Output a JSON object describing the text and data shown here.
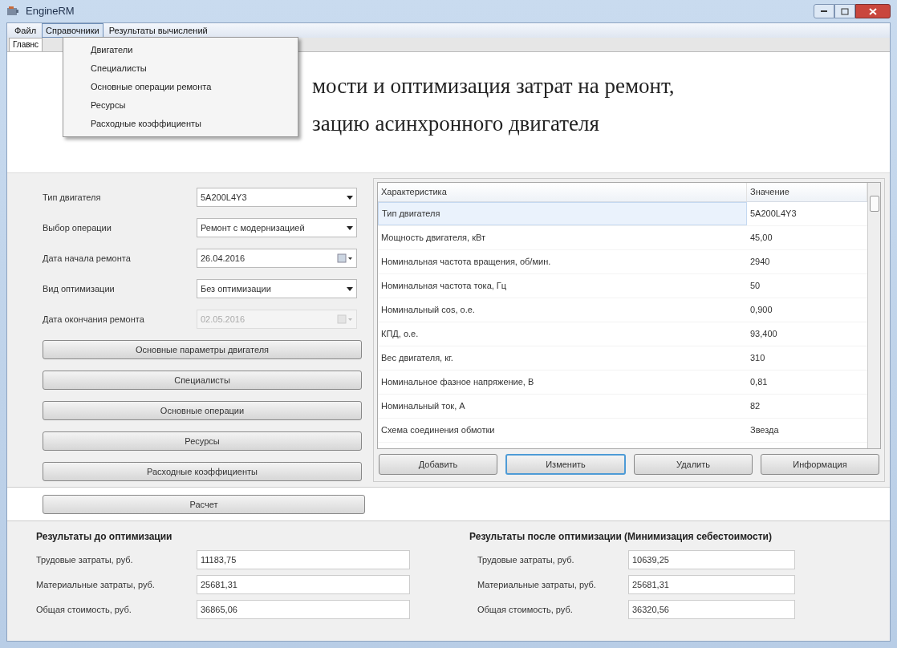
{
  "window": {
    "title": "EngineRM"
  },
  "menu": [
    {
      "label": "Файл",
      "selected": false
    },
    {
      "label": "Справочники",
      "selected": true
    },
    {
      "label": "Результаты вычислений",
      "selected": false
    }
  ],
  "dropdown": [
    "Двигатели",
    "Специалисты",
    "Основные операции ремонта",
    "Ресурсы",
    "Расходные коэффициенты"
  ],
  "tabs": [
    {
      "label": "Главнс",
      "selected": true
    }
  ],
  "heading": [
    "мости и оптимизация затрат на ремонт,",
    "зацию асинхронного двигателя"
  ],
  "form": [
    {
      "label": "Тип двигателя",
      "kind": "combo",
      "value": "5A200L4Y3",
      "disabled": false
    },
    {
      "label": "Выбор операции",
      "kind": "combo",
      "value": "Ремонт с модернизацией",
      "disabled": false
    },
    {
      "label": "Дата начала ремонта",
      "kind": "date",
      "value": "26.04.2016",
      "disabled": false
    },
    {
      "label": "Вид оптимизации",
      "kind": "combo",
      "value": "Без оптимизации",
      "disabled": false
    },
    {
      "label": "Дата окончания ремонта",
      "kind": "date",
      "value": "02.05.2016",
      "disabled": true
    }
  ],
  "side_buttons": [
    "Основные параметры двигателя",
    "Специалисты",
    "Основные операции",
    "Ресурсы",
    "Расходные коэффициенты"
  ],
  "table": {
    "columns": [
      "Характеристика",
      "Значение"
    ],
    "rows": [
      {
        "cells": [
          "Тип двигателя",
          "5A200L4Y3"
        ],
        "selected": true
      },
      {
        "cells": [
          "Мощность двигателя, кВт",
          "45,00"
        ],
        "selected": false
      },
      {
        "cells": [
          "Номинальная частота вращения, об/мин.",
          "2940"
        ],
        "selected": false
      },
      {
        "cells": [
          "Номинальная частота тока, Гц",
          "50"
        ],
        "selected": false
      },
      {
        "cells": [
          "Номинальный cos, о.е.",
          "0,900"
        ],
        "selected": false
      },
      {
        "cells": [
          "КПД, о.е.",
          "93,400"
        ],
        "selected": false
      },
      {
        "cells": [
          "Вес двигателя, кг.",
          "310"
        ],
        "selected": false
      },
      {
        "cells": [
          "Номинальное фазное напряжение, В",
          "0,81"
        ],
        "selected": false
      },
      {
        "cells": [
          "Номинальный ток, А",
          "82"
        ],
        "selected": false
      },
      {
        "cells": [
          "Схема соединения обмотки",
          "Звезда"
        ],
        "selected": false
      }
    ]
  },
  "table_buttons": [
    {
      "label": "Добавить",
      "focused": false
    },
    {
      "label": "Изменить",
      "focused": true
    },
    {
      "label": "Удалить",
      "focused": false
    },
    {
      "label": "Информация",
      "focused": false
    }
  ],
  "calc_button": "Расчет",
  "results": [
    {
      "title": "Результаты до оптимизации",
      "rows": [
        {
          "label": "Трудовые затраты, руб.",
          "value": "11183,75"
        },
        {
          "label": "Материальные затраты, руб.",
          "value": "25681,31"
        },
        {
          "label": "Общая стоимость, руб.",
          "value": "36865,06"
        }
      ]
    },
    {
      "title": "Результаты после оптимизации (Минимизация себестоимости)",
      "rows": [
        {
          "label": "Трудовые затраты, руб.",
          "value": "10639,25"
        },
        {
          "label": "Материальные затраты, руб.",
          "value": "25681,31"
        },
        {
          "label": "Общая стоимость, руб.",
          "value": "36320,56"
        }
      ]
    }
  ]
}
